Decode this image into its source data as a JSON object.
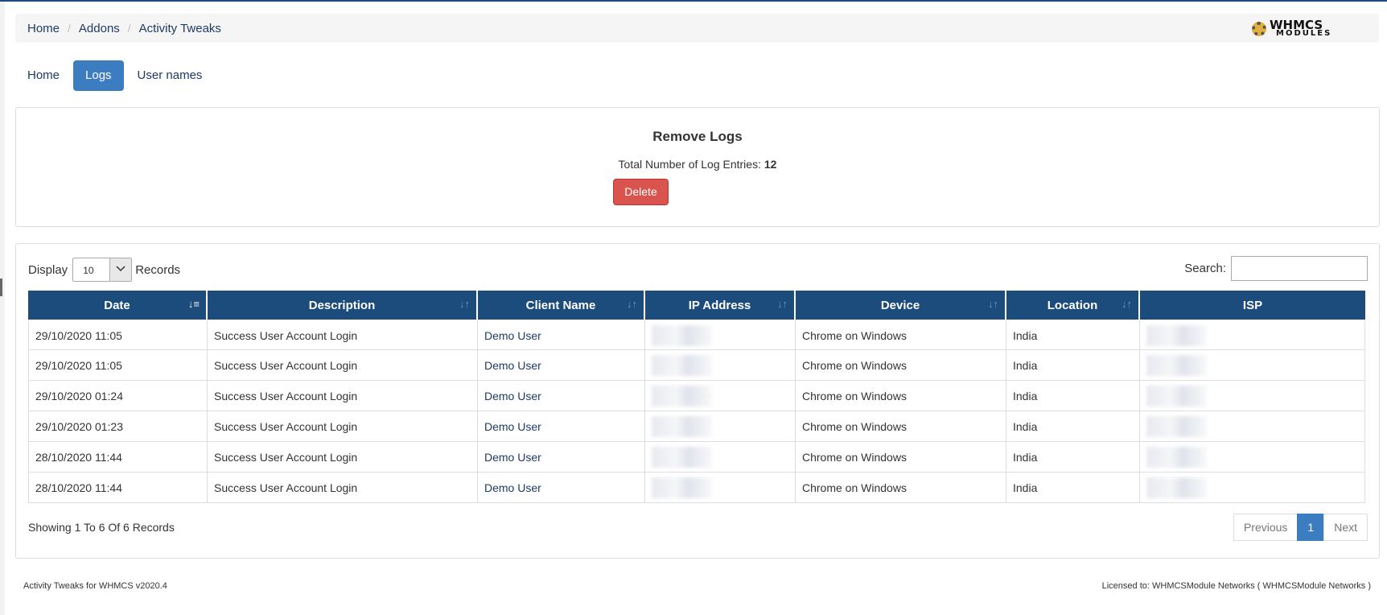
{
  "breadcrumb": {
    "items": [
      "Home",
      "Addons"
    ],
    "current": "Activity Tweaks"
  },
  "logo": {
    "line1": "WHMCS",
    "line2": "MODULES"
  },
  "tabs": [
    {
      "label": "Home",
      "active": false
    },
    {
      "label": "Logs",
      "active": true
    },
    {
      "label": "User names",
      "active": false
    }
  ],
  "remove_logs": {
    "title": "Remove Logs",
    "count_label": "Total Number of Log Entries:",
    "count_value": "12",
    "delete_label": "Delete"
  },
  "records": {
    "display_label": "Display",
    "display_value": "10",
    "records_label": "Records",
    "search_label": "Search:",
    "search_value": ""
  },
  "table": {
    "columns": [
      "Date",
      "Description",
      "Client Name",
      "IP Address",
      "Device",
      "Location",
      "ISP"
    ],
    "rows": [
      {
        "date": "29/10/2020 11:05",
        "description": "Success User Account Login",
        "client": "Demo User",
        "device": "Chrome on Windows",
        "location": "India"
      },
      {
        "date": "29/10/2020 11:05",
        "description": "Success User Account Login",
        "client": "Demo User",
        "device": "Chrome on Windows",
        "location": "India"
      },
      {
        "date": "29/10/2020 01:24",
        "description": "Success User Account Login",
        "client": "Demo User",
        "device": "Chrome on Windows",
        "location": "India"
      },
      {
        "date": "29/10/2020 01:23",
        "description": "Success User Account Login",
        "client": "Demo User",
        "device": "Chrome on Windows",
        "location": "India"
      },
      {
        "date": "28/10/2020 11:44",
        "description": "Success User Account Login",
        "client": "Demo User",
        "device": "Chrome on Windows",
        "location": "India"
      },
      {
        "date": "28/10/2020 11:44",
        "description": "Success User Account Login",
        "client": "Demo User",
        "device": "Chrome on Windows",
        "location": "India"
      }
    ]
  },
  "pagination": {
    "showing": "Showing 1 To 6 Of 6 Records",
    "previous": "Previous",
    "current_page": "1",
    "next": "Next"
  },
  "footer": {
    "left": "Activity Tweaks for WHMCS v2020.4",
    "right": "Licensed to: WHMCSModule Networks ( WHMCSModule Networks )"
  },
  "colors": {
    "header_bg": "#1b4c7c",
    "active_tab": "#3b7dc0",
    "delete": "#d9534f",
    "link": "#1e3a66"
  }
}
